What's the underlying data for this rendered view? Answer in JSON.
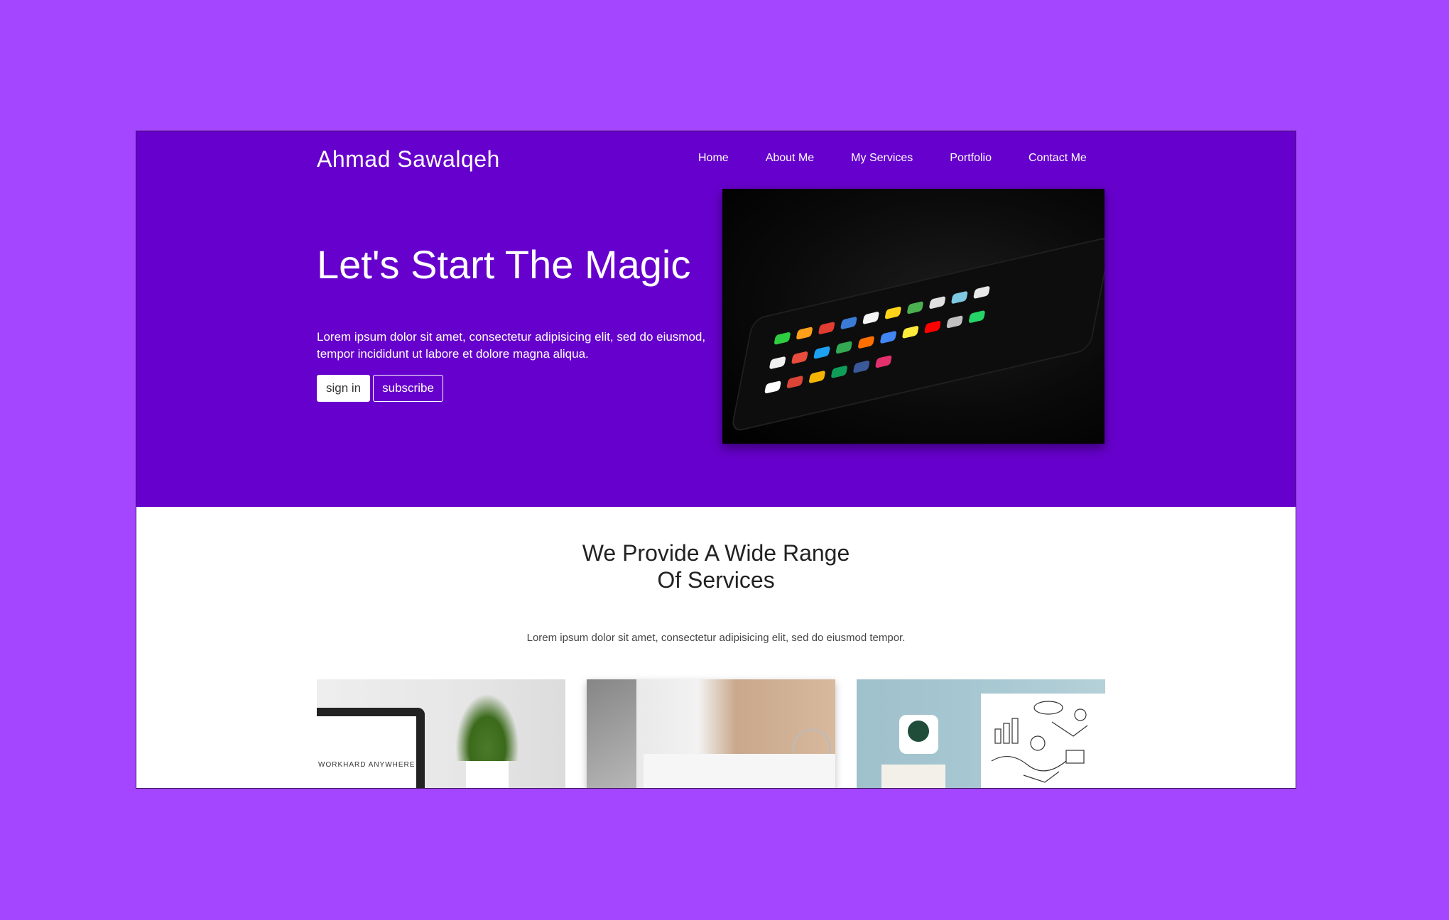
{
  "colors": {
    "page_bg": "#a445ff",
    "hero_bg": "#6600cc",
    "text_light": "#ffffff",
    "text_dark": "#222222"
  },
  "header": {
    "brand": "Ahmad Sawalqeh",
    "nav": [
      {
        "label": "Home"
      },
      {
        "label": "About Me"
      },
      {
        "label": "My Services"
      },
      {
        "label": "Portfolio"
      },
      {
        "label": "Contact Me"
      }
    ]
  },
  "hero": {
    "title": "Let's Start The Magic",
    "text": "Lorem ipsum dolor sit amet, consectetur adipisicing elit, sed do eiusmod, tempor incididunt ut labore et dolore magna aliqua.",
    "sign_in_label": "sign in",
    "subscribe_label": "subscribe",
    "image": "smartphone-apps-photo"
  },
  "services": {
    "title_line1": "We Provide A Wide Range",
    "title_line2": "Of Services",
    "text": "Lorem ipsum dolor sit amet, consectetur adipisicing elit, sed do eiusmod tempor.",
    "cards": [
      {
        "image": "laptop-plant-photo",
        "caption": "WORKHARD ANYWHERE"
      },
      {
        "image": "office-desk-photo"
      },
      {
        "image": "desk-sketches-photo"
      }
    ]
  }
}
